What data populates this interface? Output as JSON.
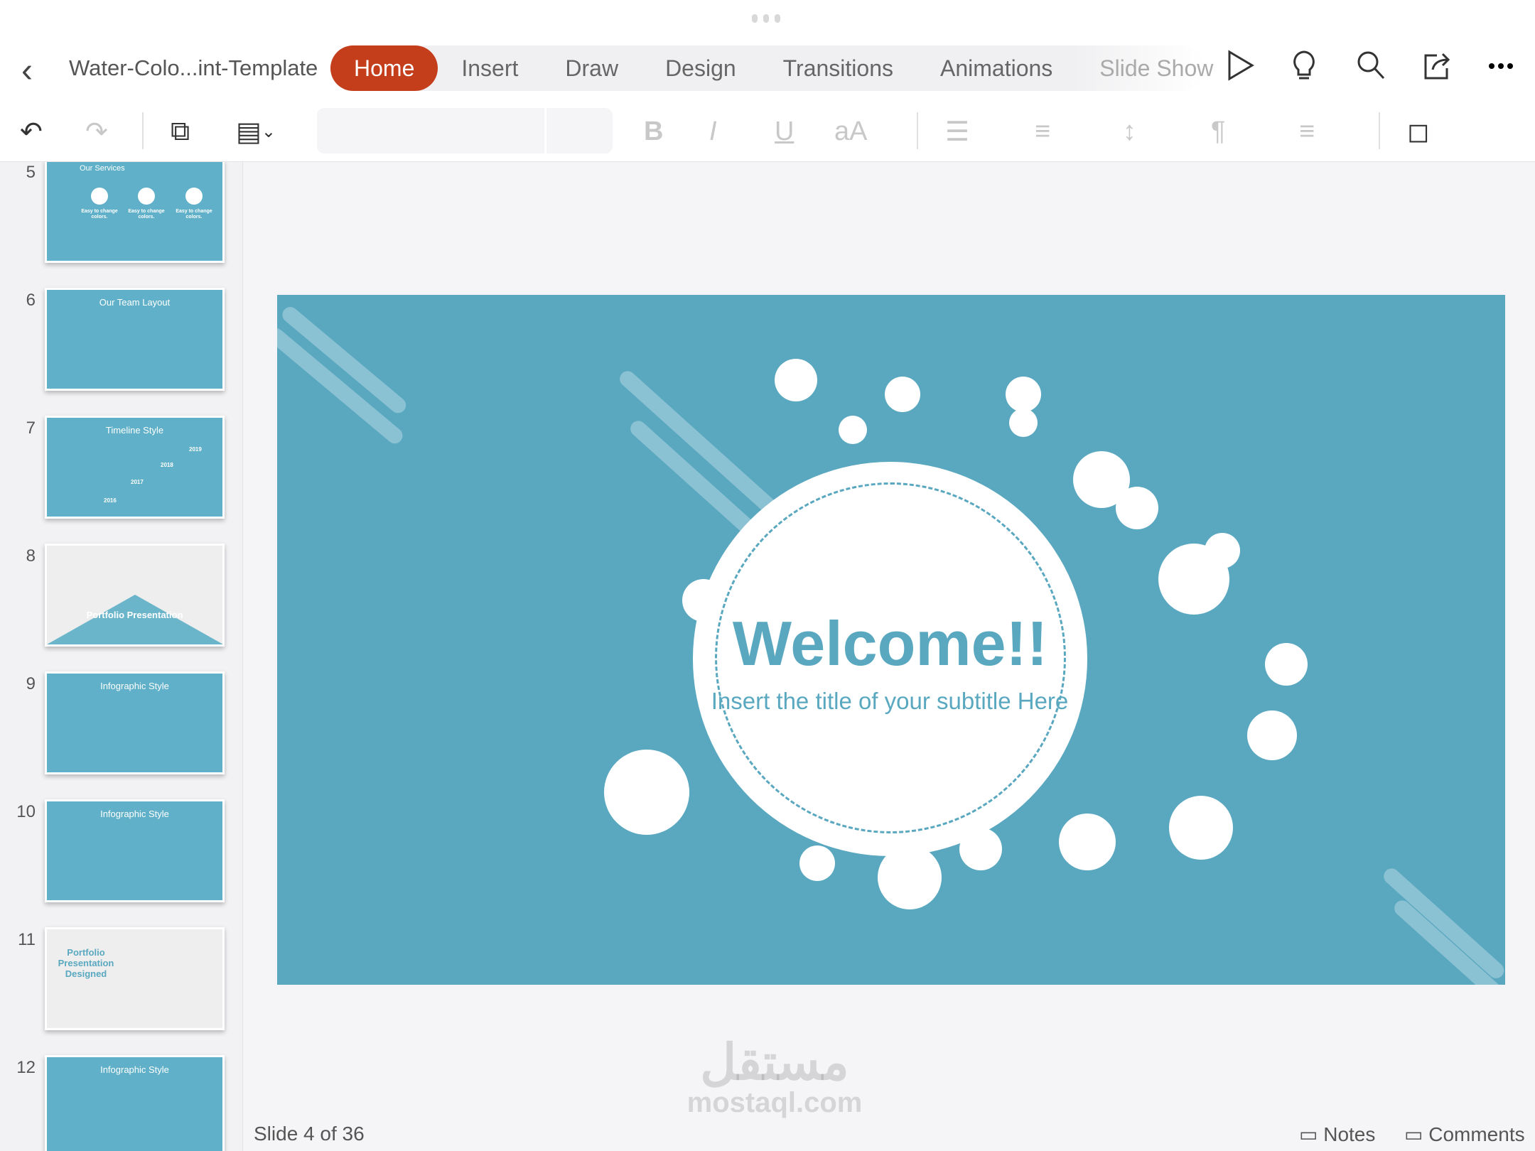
{
  "header": {
    "back": "‹",
    "document_title": "Water-Colo...int-Template",
    "tabs": [
      {
        "label": "Home",
        "active": true
      },
      {
        "label": "Insert"
      },
      {
        "label": "Draw"
      },
      {
        "label": "Design"
      },
      {
        "label": "Transitions"
      },
      {
        "label": "Animations"
      },
      {
        "label": "Slide Show"
      }
    ],
    "icons": [
      "play-icon",
      "lightbulb-icon",
      "search-icon",
      "share-icon",
      "more-icon"
    ]
  },
  "toolbar": {
    "undo": "↶",
    "redo": "↷",
    "new_slide": "⧉",
    "layout": "▤",
    "bold": "B",
    "italic": "I",
    "underline": "U",
    "font_size": "aA",
    "bullets": "☰",
    "numbering": "≡",
    "line_spacing": "↕",
    "paragraph": "¶",
    "align": "≡",
    "shapes": "◻",
    "chevron": "⌄",
    "font_name": "",
    "font_size_value": ""
  },
  "sidebar": {
    "thumbnails": [
      {
        "number": "5",
        "title": "Our Services",
        "items": [
          "Easy to change colors.",
          "Easy to change colors.",
          "Easy to change colors."
        ]
      },
      {
        "number": "6",
        "title": "Our Team Layout"
      },
      {
        "number": "7",
        "title": "Timeline Style",
        "years": [
          "2016",
          "2017",
          "2018",
          "2019"
        ]
      },
      {
        "number": "8",
        "title": "Portfolio Presentation"
      },
      {
        "number": "9",
        "title": "Infographic Style"
      },
      {
        "number": "10",
        "title": "Infographic Style"
      },
      {
        "number": "11",
        "title": "Portfolio Presentation Designed"
      },
      {
        "number": "12",
        "title": "Infographic Style"
      }
    ]
  },
  "slide": {
    "title": "Welcome!!",
    "subtitle": "Insert the title of your subtitle Here",
    "background": "#5aa8c0"
  },
  "status": {
    "slide_indicator": "Slide 4 of 36",
    "notes": "Notes",
    "comments": "Comments"
  },
  "watermark": {
    "arabic": "مستقل",
    "latin": "mostaql.com"
  },
  "colors": {
    "accent": "#c43e1c",
    "slide": "#5aa8c0"
  }
}
